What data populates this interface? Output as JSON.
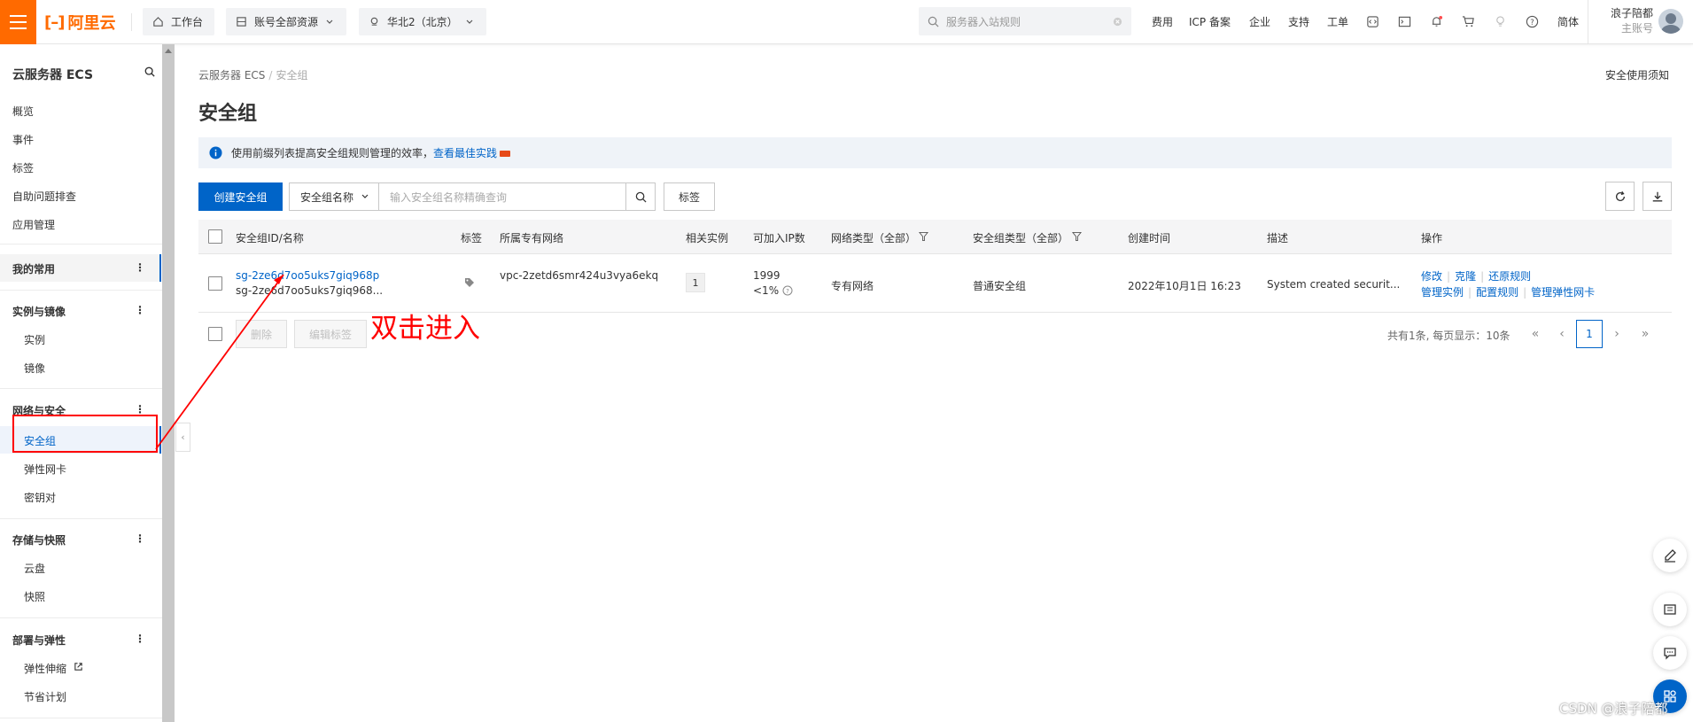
{
  "topbar": {
    "logo_text": "阿里云",
    "workbench": "工作台",
    "resource_scope": "账号全部资源",
    "region": "华北2（北京）",
    "search_placeholder": "服务器入站规则",
    "links": [
      "费用",
      "ICP 备案",
      "企业",
      "支持",
      "工单"
    ],
    "language": "简体",
    "user_name": "浪子陪都",
    "user_role": "主账号",
    "brand_color": "#ff6a00"
  },
  "sidebar": {
    "title": "云服务器 ECS",
    "top_items": [
      "概览",
      "事件",
      "标签",
      "自助问题排查",
      "应用管理"
    ],
    "favorites": "我的常用",
    "groups": [
      {
        "label": "实例与镜像",
        "items": [
          "实例",
          "镜像"
        ]
      },
      {
        "label": "网络与安全",
        "items": [
          "安全组",
          "弹性网卡",
          "密钥对"
        ]
      },
      {
        "label": "存储与快照",
        "items": [
          "云盘",
          "快照"
        ]
      },
      {
        "label": "部署与弹性",
        "items": [
          "弹性伸缩",
          "节省计划"
        ]
      }
    ],
    "dots": "⋮"
  },
  "breadcrumb": {
    "root": "云服务器 ECS",
    "sep": "/",
    "current": "安全组"
  },
  "notice_link": "安全使用须知",
  "page_title": "安全组",
  "info": {
    "text": "使用前缀列表提高安全组规则管理的效率，",
    "link": "查看最佳实践"
  },
  "toolbar": {
    "create_button": "创建安全组",
    "filter_select": "安全组名称",
    "search_placeholder": "输入安全组名称精确查询",
    "tag_button": "标签"
  },
  "table": {
    "headers": {
      "id": "安全组ID/名称",
      "tag": "标签",
      "vpc": "所属专有网络",
      "instances": "相关实例",
      "ips": "可加入IP数",
      "net_type": "网络类型（全部）",
      "sg_type": "安全组类型（全部）",
      "created": "创建时间",
      "desc": "描述",
      "ops": "操作"
    },
    "rows": [
      {
        "id": "sg-2ze6d7oo5uks7giq968p",
        "name": "sg-2ze6d7oo5uks7giq968...",
        "vpc": "vpc-2zetd6smr424u3vya6ekq",
        "instances": "1",
        "ips": "1999",
        "ips_pct": "<1%",
        "net_type": "专有网络",
        "sg_type": "普通安全组",
        "created": "2022年10月1日 16:23",
        "desc": "System created securit...",
        "ops_line1": [
          "修改",
          "克隆",
          "还原规则"
        ],
        "ops_line2": [
          "管理实例",
          "配置规则",
          "管理弹性网卡"
        ]
      }
    ]
  },
  "footer": {
    "delete": "删除",
    "edit_tags": "编辑标签",
    "pager_info": "共有1条, 每页显示：10条",
    "current_page": "1",
    "first": "«",
    "prev": "‹",
    "next": "›",
    "last": "»"
  },
  "annotation": "双击进入",
  "watermark": "CSDN @浪子陪都"
}
